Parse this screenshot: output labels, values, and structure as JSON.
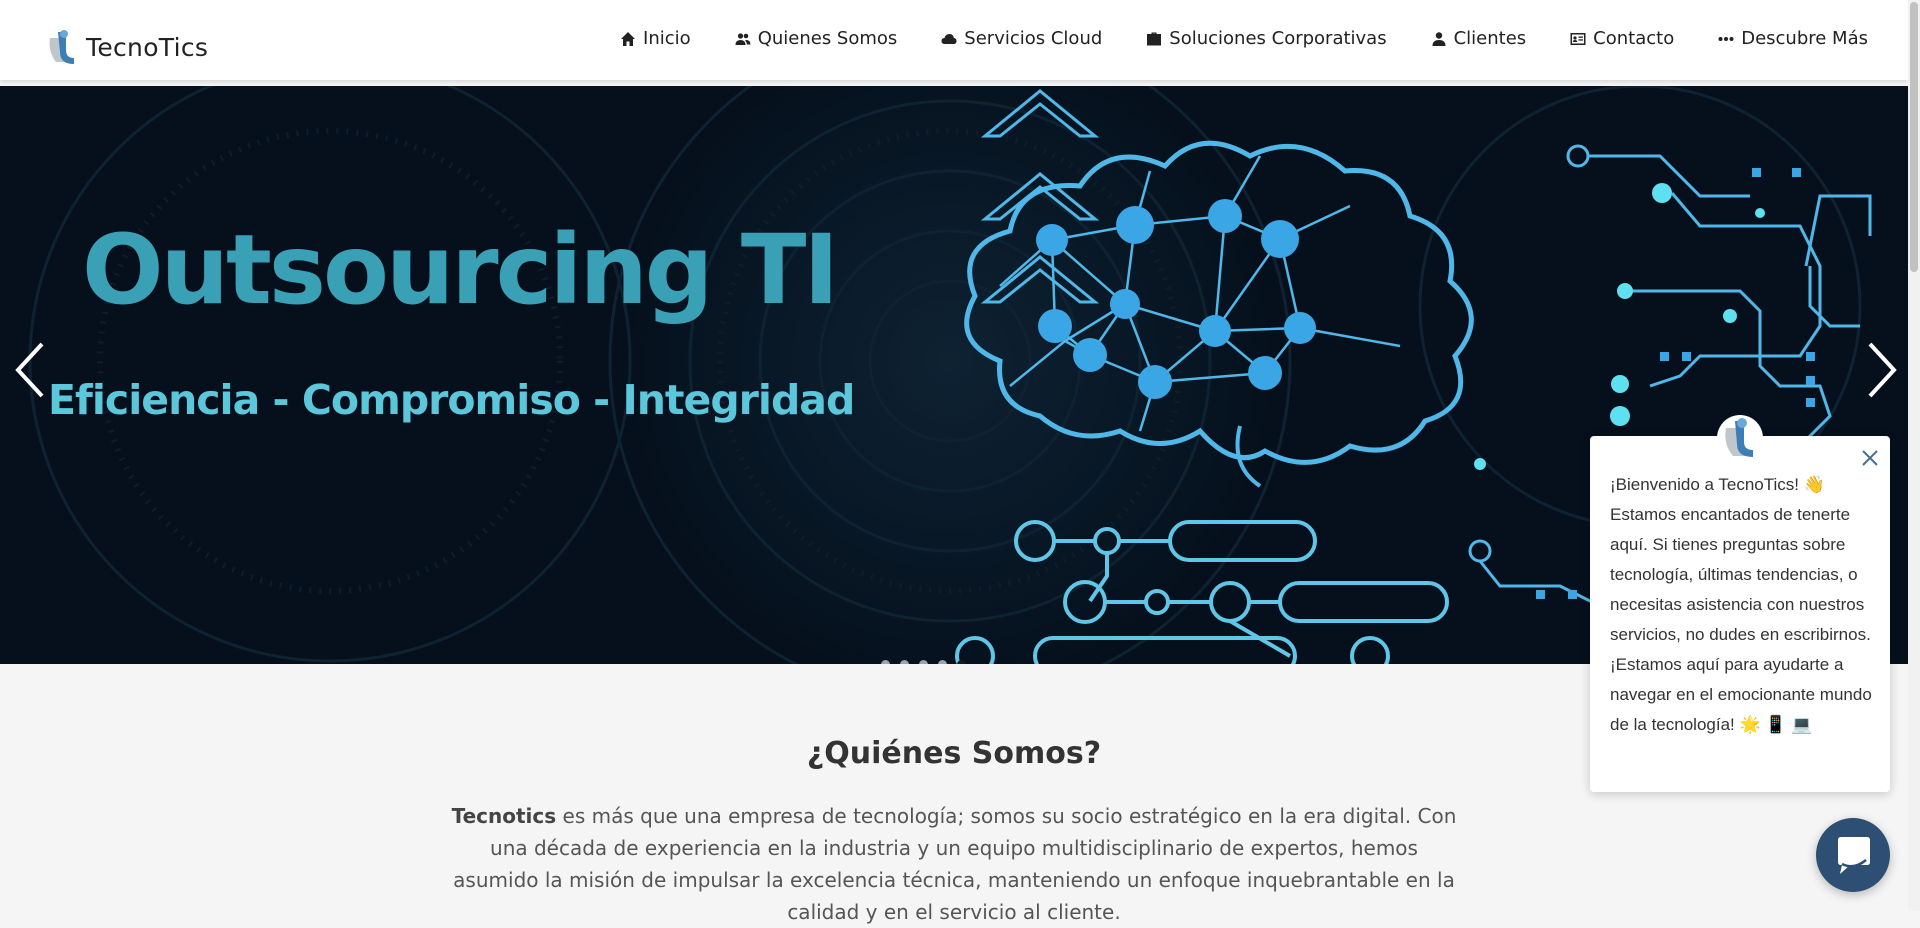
{
  "header": {
    "brand": "TecnoTics",
    "nav": [
      {
        "label": "Inicio",
        "icon": "home-icon"
      },
      {
        "label": "Quienes Somos",
        "icon": "users-icon"
      },
      {
        "label": "Servicios Cloud",
        "icon": "cloud-icon"
      },
      {
        "label": "Soluciones Corporativas",
        "icon": "briefcase-icon"
      },
      {
        "label": "Clientes",
        "icon": "user-icon"
      },
      {
        "label": "Contacto",
        "icon": "id-card-icon"
      },
      {
        "label": "Descubre Más",
        "icon": "ellipsis-icon"
      }
    ]
  },
  "hero": {
    "title": "Outsourcing TI",
    "subtitle": "Eficiencia - Compromiso - Integridad",
    "slide_count": 5,
    "active_slide": 5
  },
  "about": {
    "heading": "¿Quiénes Somos?",
    "brand_bold": "Tecnotics",
    "text": " es más que una empresa de tecnología; somos su socio estratégico en la era digital. Con una década de experiencia en la industria y un equipo multidisciplinario de expertos, hemos asumido la misión de impulsar la excelencia técnica, manteniendo un enfoque inquebrantable en la calidad y en el servicio al cliente."
  },
  "chat": {
    "message": "¡Bienvenido a TecnoTics! 👋 Estamos encantados de tenerte aquí. Si tienes preguntas sobre tecnología, últimas tendencias, o necesitas asistencia con nuestros servicios, no dudes en escribirnos. ¡Estamos aquí para ayudarte a navegar en el emocionante mundo de la tecnología! 🌟 📱 💻"
  },
  "colors": {
    "hero_bg": "#05101c",
    "hero_title": "#3aa0b6",
    "hero_subtitle": "#5cc6da",
    "circuit": "#4fb8e8",
    "chat_launcher": "#2d4f74"
  }
}
